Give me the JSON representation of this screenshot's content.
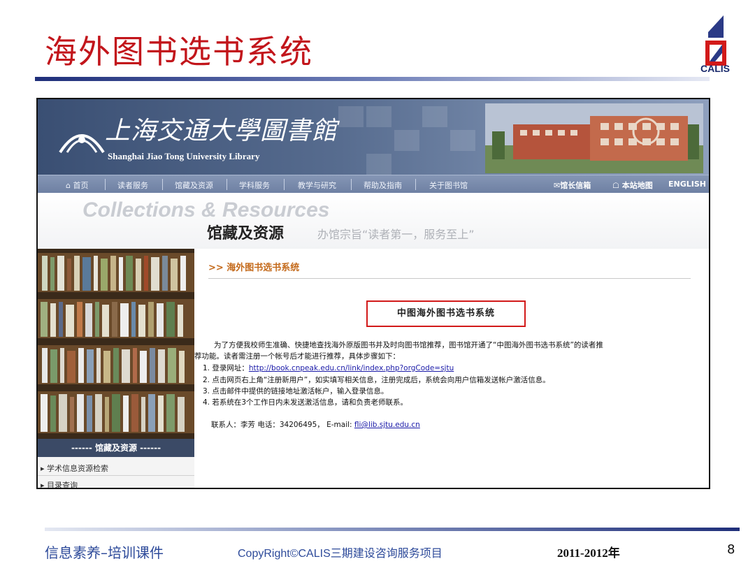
{
  "slide": {
    "title": "海外图书选书系统",
    "logo_text": "CALIS",
    "footer_left": "信息素养–培训课件",
    "footer_mid": "CopyRight©CALIS三期建设咨询服务项目",
    "footer_year": "2011-2012年",
    "page_number": "8"
  },
  "site": {
    "name_cn": "上海交通大學圖書館",
    "name_en": "Shanghai Jiao Tong University Library",
    "nav": [
      "⌂ 首页",
      "读者服务",
      "馆藏及资源",
      "学科服务",
      "教学与研究",
      "帮助及指南",
      "关于图书馆"
    ],
    "nav_right": [
      "✉馆长信箱",
      "☖ 本站地图",
      "ENGLISH"
    ],
    "hero_en": "Collections & Resources",
    "hero_cn": "馆藏及资源",
    "hero_slogan": "办馆宗旨“读者第一，服务至上”",
    "sidebar_header": "------ 馆藏及资源 ------",
    "sidebar_items": [
      "▸ 学术信息资源检索",
      "▸ 目录查询"
    ]
  },
  "content": {
    "breadcrumb": ">> 海外图书选书系统",
    "box_title": "中图海外图书选书系统",
    "para1": "为了方便我校师生准确、快捷地查找海外原版图书并及时向图书馆推荐，图书馆开通了“中图海外图书选书系统”的读者推",
    "para2": "荐功能。读者需注册一个帐号后才能进行推荐，具体步骤如下：",
    "step1_prefix": "1. 登录网址：",
    "step1_url": "http://book.cnpeak.edu.cn/link/index.php?orgCode=sjtu",
    "step2": "2. 点击网页右上角“注册新用户”，如实填写相关信息，注册完成后，系统会向用户信箱发送帐户激活信息。",
    "step3": "3. 点击邮件中提供的链接地址激活帐户，输入登录信息。",
    "step4": "4. 若系统在3个工作日内未发送激活信息，请和负责老师联系。",
    "contact_prefix": "联系人：李芳    电话：34206495，  E-mail: ",
    "contact_email": "fli@lib.sjtu.edu.cn"
  }
}
